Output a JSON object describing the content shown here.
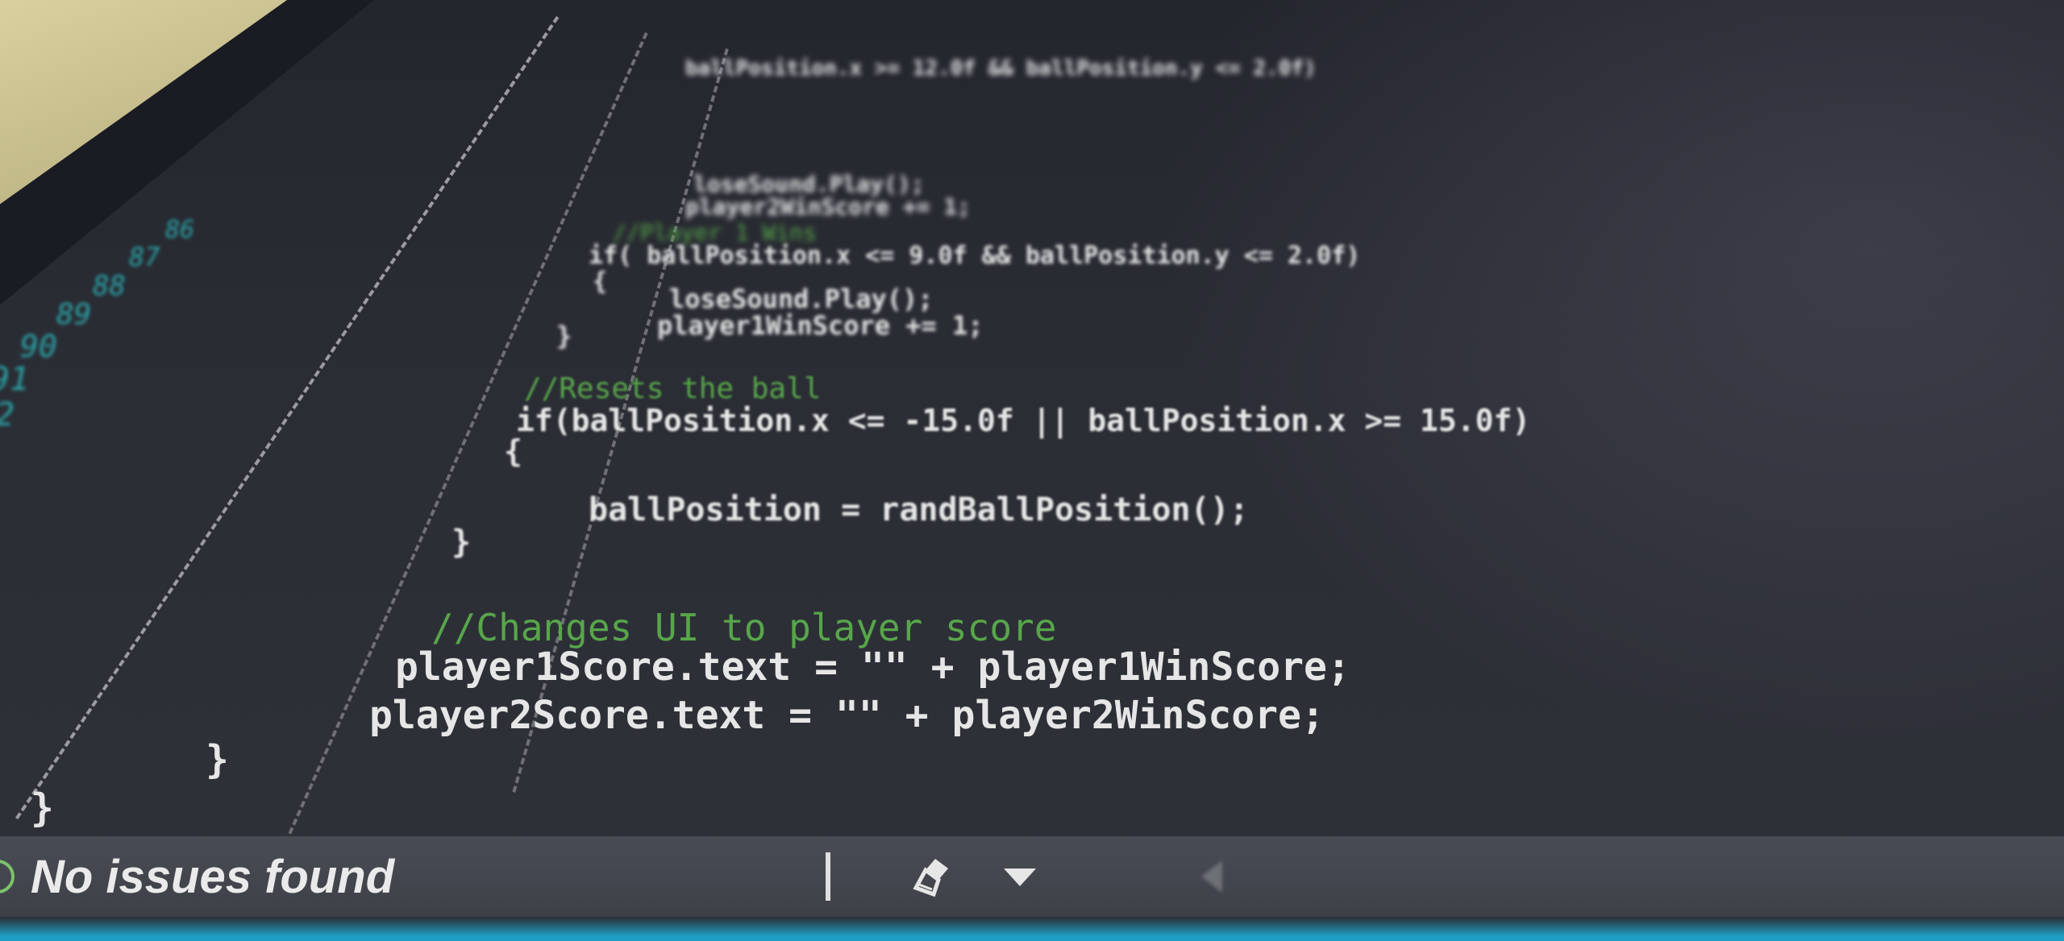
{
  "editor": {
    "line_numbers": [
      "86",
      "87",
      "88",
      "89",
      "90",
      "91",
      "2"
    ],
    "code": [
      {
        "text": "ballPosition.x >= 12.0f && ballPosition.y <= 2.0f)",
        "kind": "code"
      },
      {
        "text": "loseSound.Play();",
        "kind": "code"
      },
      {
        "text": "player2WinScore += 1;",
        "kind": "code"
      },
      {
        "text": "//Player 1 Wins",
        "kind": "comment"
      },
      {
        "text": "if( ballPosition.x <= 9.0f && ballPosition.y <= 2.0f)",
        "kind": "code"
      },
      {
        "text": "{",
        "kind": "code"
      },
      {
        "text": "loseSound.Play();",
        "kind": "code"
      },
      {
        "text": "player1WinScore += 1;",
        "kind": "code"
      },
      {
        "text": "}",
        "kind": "code"
      },
      {
        "text": "//Resets the ball",
        "kind": "comment"
      },
      {
        "text": "if(ballPosition.x <= -15.0f || ballPosition.x >= 15.0f)",
        "kind": "code"
      },
      {
        "text": "{",
        "kind": "code"
      },
      {
        "text": "ballPosition = randBallPosition();",
        "kind": "code"
      },
      {
        "text": "}",
        "kind": "code"
      },
      {
        "text": "//Changes UI to player score",
        "kind": "comment"
      },
      {
        "text": "player1Score.text = \"\" + player1WinScore;",
        "kind": "code"
      },
      {
        "text": "player2Score.text = \"\" + player2WinScore;",
        "kind": "code"
      },
      {
        "text": "}",
        "kind": "code"
      },
      {
        "text": "}",
        "kind": "code"
      }
    ]
  },
  "statusbar": {
    "issues_text": "No issues found"
  },
  "colors": {
    "editor_bg": "#2b2d35",
    "comment": "#57a64a",
    "line_number": "#2aa3a6",
    "status_ok": "#7cc36b"
  },
  "icons": {
    "status": "check-circle-icon",
    "cleanup": "brush-icon",
    "dropdown": "chevron-down-icon",
    "nav": "arrow-left-icon"
  }
}
